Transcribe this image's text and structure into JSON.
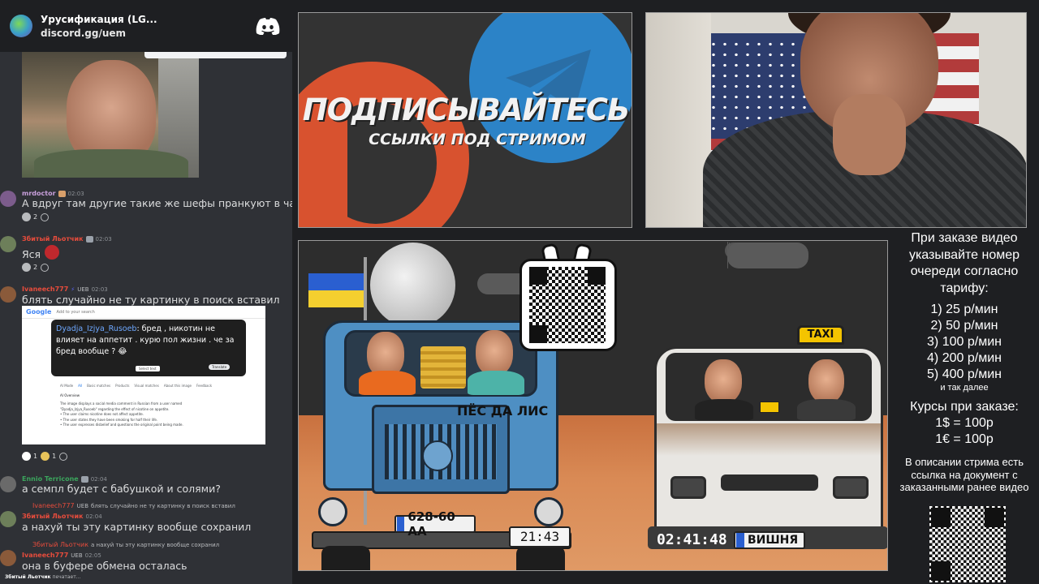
{
  "server": {
    "name": "Урусификация (LG...",
    "invite": "discord.gg/uem"
  },
  "messages": [
    {
      "author": "mrdoctor",
      "author_color": "#c9a0dc",
      "time": "02:03",
      "text": "А вдруг там другие такие же шефы пранкуют в чате",
      "reaction_count": "2"
    },
    {
      "author": "Збитый Льотчик",
      "author_color": "#e74c3c",
      "time": "02:03",
      "text": "Яся",
      "reaction_count": "2"
    },
    {
      "author": "Ivaneech777",
      "author_color": "#e74c3c",
      "tag": "UEB",
      "time": "02:03",
      "text": "блять случайно не ту картинку в поиск вставил",
      "reaction_1_count": "1",
      "reaction_2_count": "1"
    },
    {
      "author": "Ennio Terricone",
      "author_color": "#3ba55d",
      "time": "02:04",
      "text": "а семпл будет с бабушкой и солями?"
    },
    {
      "reply_author": "Ivaneech777",
      "reply_tag": "UEB",
      "reply_text": "блять случайно не ту картинку в поиск вставил",
      "author": "Збитый Льотчик",
      "author_color": "#e74c3c",
      "time": "02:04",
      "text": "а нахуй ты эту картинку вообще сохранил"
    },
    {
      "reply_author": "Збитый Льотчик",
      "reply_text": "а нахуй ты эту картинку вообще сохранил",
      "author": "Ivaneech777",
      "author_color": "#e74c3c",
      "tag": "UEB",
      "time": "02:05",
      "text": "она в буфере обмена осталась"
    }
  ],
  "typing": {
    "name": "Збитый Льотчик",
    "suffix": "печатает..."
  },
  "google_screenshot": {
    "logo": "Google",
    "search_hint": "Add to your search",
    "mention": "Dyadja_Izjya_Rusoeb",
    "text": ": бред , никотин не влияет на аппетит . курю пол жизни . че за бред вообще ? 😂",
    "select_btn": "Select text",
    "translate_btn": "Translate",
    "tabs": [
      "AI Mode",
      "All",
      "Basic matches",
      "Products",
      "Visual matches",
      "About this image",
      "Feedback"
    ],
    "ai_overview": "AI Overview",
    "lines": [
      "The image displays a social media comment in Russian from a user named",
      "\"Dyadja_Izjya_Rusoeb\" regarding the effect of nicotine on appetite.",
      "• The user claims nicotine does not affect appetite.",
      "• The user states they have been smoking for half their life.",
      "• The user expresses disbelief and questions the original point being made."
    ]
  },
  "banner": {
    "title": "ПОДПИСЫВАЙТЕСЬ",
    "subtitle": "ССЫЛКИ ПОД СТРИМОМ"
  },
  "game": {
    "truck_name": "ПЁС ДА ЛИС",
    "truck_plate": "628-60 AA",
    "truck_timer": "21:43",
    "van_sign": "TAXI",
    "van_timer": "02:41:48",
    "van_plate": "ВИШНЯ"
  },
  "info": {
    "header": "При заказе видео указывайте номер очереди согласно тарифу:",
    "prices": [
      "1) 25 р/мин",
      "2) 50 р/мин",
      "3) 100 р/мин",
      "4) 200 р/мин",
      "5) 400 р/мин"
    ],
    "more": "и так далее",
    "rates_title": "Курсы при заказе:",
    "rates": [
      "1$ = 100р",
      "1€ = 100р"
    ],
    "desc": "В описании стрима есть ссылка на документ с заказанными ранее видео"
  }
}
